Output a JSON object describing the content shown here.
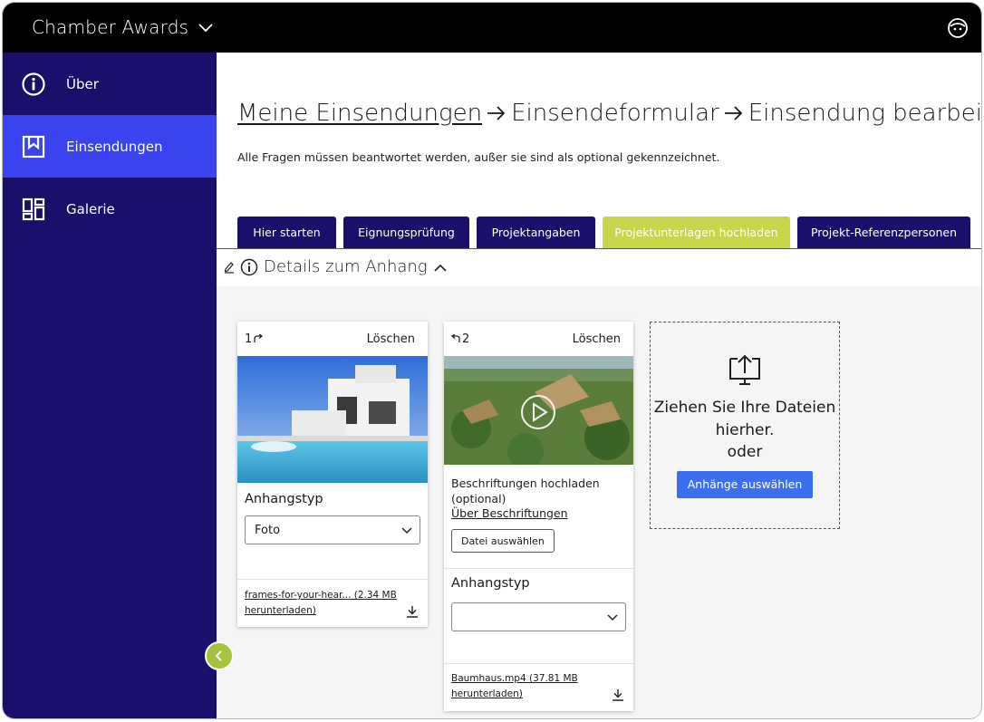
{
  "app": {
    "title": "Chamber Awards"
  },
  "sidebar": {
    "items": [
      {
        "label": "Über",
        "icon": "info-icon"
      },
      {
        "label": "Einsendungen",
        "icon": "bookmark-icon"
      },
      {
        "label": "Galerie",
        "icon": "grid-icon"
      }
    ]
  },
  "breadcrumb": {
    "level1": "Meine Einsendungen ",
    "level2": "Einsendeformular",
    "level3": "Einsendung bearbeiten"
  },
  "hint": "Alle Fragen müssen beantwortet werden, außer sie sind als optional gekennzeichnet.",
  "tabs": [
    {
      "label": "Hier starten"
    },
    {
      "label": "Eignungsprüfung"
    },
    {
      "label": "Projektangaben"
    },
    {
      "label": "Projektunterlagen hochladen"
    },
    {
      "label": "Projekt-Referenzpersonen"
    }
  ],
  "details": {
    "title": "Details zum Anhang"
  },
  "cards": [
    {
      "order": "1",
      "delete": "Löschen",
      "type_label": "Anhangstyp",
      "type_value": "Foto",
      "download": "frames-for-your-hear... (2.34 MB herunterladen)"
    },
    {
      "order": "2",
      "delete": "Löschen",
      "caption_title": "Beschriftungen hochladen (optional)",
      "caption_link": "Über Beschriftungen",
      "file_button": "Datei auswählen",
      "type_label": "Anhangstyp",
      "type_value": "",
      "download": "Baumhaus.mp4 (37.81 MB herunterladen)"
    }
  ],
  "dropzone": {
    "line1": "Ziehen Sie Ihre Dateien",
    "line2": "hierher.",
    "line3": "oder",
    "button": "Anhänge auswählen"
  },
  "colors": {
    "sidebar": "#1b0f6c",
    "active_nav": "#3a43f0",
    "active_tab": "#c9d54a",
    "primary_button": "#3a6ff0",
    "collapse_button": "#a5c33d"
  }
}
